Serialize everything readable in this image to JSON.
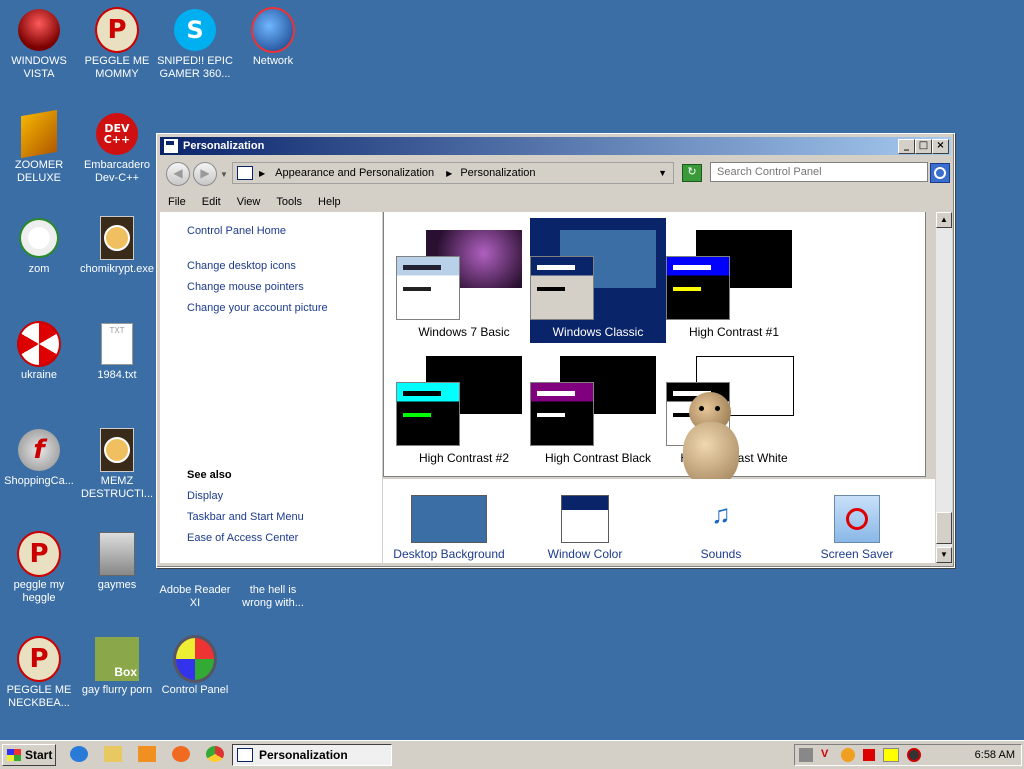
{
  "desktop": {
    "icons": [
      {
        "label": "WINDOWS VISTA"
      },
      {
        "label": "PEGGLE ME MOMMY"
      },
      {
        "label": "SNIPED!! EPIC GAMER 360..."
      },
      {
        "label": "Network"
      },
      {
        "label": "ZOOMER DELUXE"
      },
      {
        "label": "Embarcadero Dev-C++"
      },
      {
        "label": "zom"
      },
      {
        "label": "chomikrypt.exe"
      },
      {
        "label": "ukraine"
      },
      {
        "label": "1984.txt"
      },
      {
        "label": "ShoppingCa..."
      },
      {
        "label": "MEMZ DESTRUCTI..."
      },
      {
        "label": "peggle my heggle"
      },
      {
        "label": "gaymes"
      },
      {
        "label": "Adobe Reader XI"
      },
      {
        "label": "the hell is wrong with..."
      },
      {
        "label": "PEGGLE ME NECKBEA..."
      },
      {
        "label": "gay flurry porn"
      },
      {
        "label": "Control Panel"
      }
    ],
    "icon_text": {
      "p": "P",
      "dev": "DEV",
      "cpp": "C++",
      "skype": "S",
      "box": "Box",
      "flash": "f",
      "txt": "TXT"
    }
  },
  "window": {
    "title": "Personalization",
    "buttons": {
      "minimize": "_",
      "maximize": "□",
      "close": "×"
    },
    "breadcrumb": [
      "Appearance and Personalization",
      "Personalization"
    ],
    "search_placeholder": "Search Control Panel",
    "menu": [
      "File",
      "Edit",
      "View",
      "Tools",
      "Help"
    ],
    "left_links": [
      "Control Panel Home",
      "Change desktop icons",
      "Change mouse pointers",
      "Change your account picture"
    ],
    "see_also_heading": "See also",
    "see_also_links": [
      "Display",
      "Taskbar and Start Menu",
      "Ease of Access Center"
    ],
    "themes": [
      {
        "label": "Windows 7 Basic",
        "selected": false
      },
      {
        "label": "Windows Classic",
        "selected": true
      },
      {
        "label": "High Contrast #1",
        "selected": false
      },
      {
        "label": "High Contrast #2",
        "selected": false
      },
      {
        "label": "High Contrast Black",
        "selected": false
      },
      {
        "label": "High Contrast White",
        "selected": false
      }
    ],
    "bottom_items": [
      "Desktop Background",
      "Window Color",
      "Sounds",
      "Screen Saver"
    ]
  },
  "taskbar": {
    "start_label": "Start",
    "task_label": "Personalization",
    "clock": "6:58 AM"
  },
  "colors": {
    "desktop": "#3a6ea5",
    "selection": "#0a246a",
    "link": "#1d3b8c"
  }
}
